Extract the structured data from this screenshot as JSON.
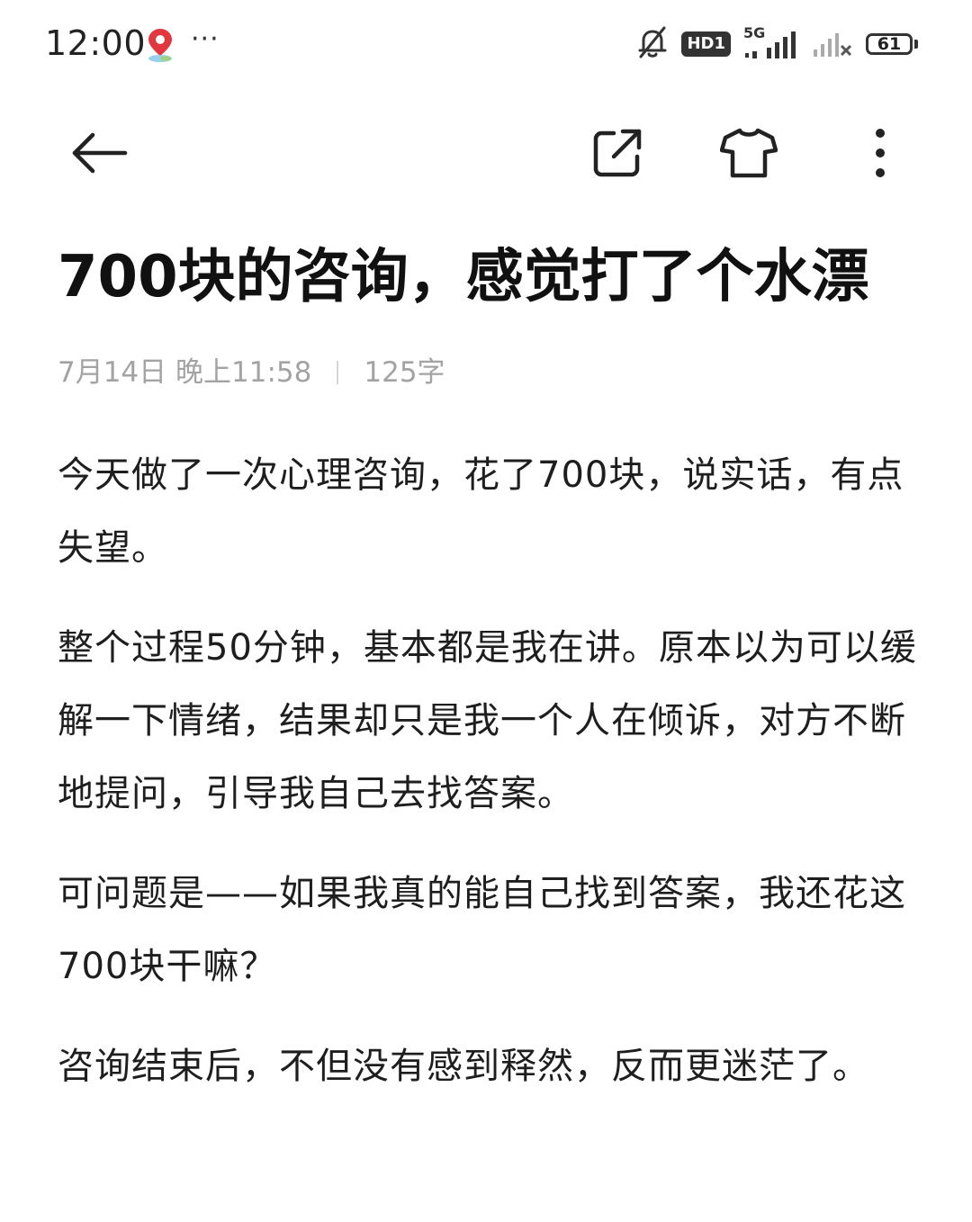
{
  "status_bar": {
    "time": "12:00",
    "more_dots": "···",
    "hd_label": "HD1",
    "network_label": "5G",
    "battery_level": "61"
  },
  "icons": {
    "back": "arrow-left-icon",
    "share": "share-external-icon",
    "theme": "tshirt-icon",
    "more": "more-vertical-icon"
  },
  "article": {
    "title": "700块的咨询，感觉打了个水漂",
    "date": "7月14日 晚上11:58",
    "word_count": "125字",
    "paragraphs": [
      "今天做了一次心理咨询，花了700块，说实话，有点失望。",
      "整个过程50分钟，基本都是我在讲。原本以为可以缓解一下情绪，结果却只是我一个人在倾诉，对方不断地提问，引导我自己去找答案。",
      "可问题是——如果我真的能自己找到答案，我还花这700块干嘛？",
      "咨询结束后，不但没有感到释然，反而更迷茫了。"
    ]
  }
}
